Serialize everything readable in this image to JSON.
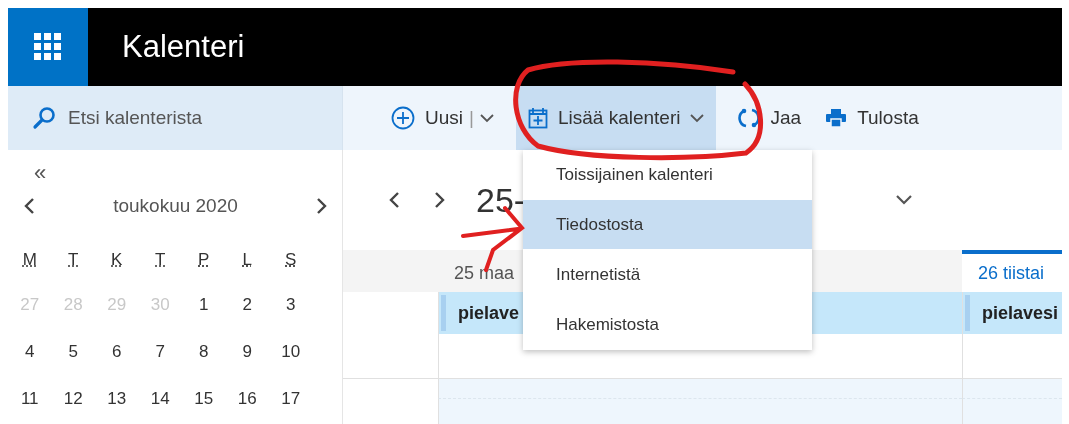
{
  "app": {
    "title": "Kalenteri"
  },
  "search": {
    "placeholder": "Etsi kalenterista"
  },
  "toolbar": [
    {
      "label": "Uusi",
      "kind": "new",
      "selected": false,
      "separator": "|"
    },
    {
      "label": "Lisää kalenteri",
      "kind": "add",
      "selected": true
    },
    {
      "label": "Jaa",
      "kind": "share",
      "selected": false
    },
    {
      "label": "Tulosta",
      "kind": "print",
      "selected": false
    }
  ],
  "mini_calendar": {
    "collapse": "«",
    "month": "toukokuu 2020",
    "weekdays": [
      "M",
      "T",
      "K",
      "T",
      "P",
      "L",
      "S"
    ],
    "weeks": [
      [
        {
          "label": "27",
          "muted": true
        },
        {
          "label": "28",
          "muted": true
        },
        {
          "label": "29",
          "muted": true
        },
        {
          "label": "30",
          "muted": true
        },
        {
          "label": "1",
          "muted": false
        },
        {
          "label": "2",
          "muted": false
        },
        {
          "label": "3",
          "muted": false
        }
      ],
      [
        {
          "label": "4",
          "muted": false
        },
        {
          "label": "5",
          "muted": false
        },
        {
          "label": "6",
          "muted": false
        },
        {
          "label": "7",
          "muted": false
        },
        {
          "label": "8",
          "muted": false
        },
        {
          "label": "9",
          "muted": false
        },
        {
          "label": "10",
          "muted": false
        }
      ],
      [
        {
          "label": "11",
          "muted": false
        },
        {
          "label": "12",
          "muted": false
        },
        {
          "label": "13",
          "muted": false
        },
        {
          "label": "14",
          "muted": false
        },
        {
          "label": "15",
          "muted": false
        },
        {
          "label": "16",
          "muted": false
        },
        {
          "label": "17",
          "muted": false
        }
      ]
    ]
  },
  "day_view": {
    "range": "25-",
    "days": [
      {
        "label": "25 maa",
        "today": false,
        "event": "pielave"
      },
      {
        "label": "26 tiistai",
        "today": true,
        "event": "pielavesi"
      }
    ]
  },
  "menu": {
    "items": [
      {
        "label": "Toissijainen kalenteri",
        "selected": false
      },
      {
        "label": "Tiedostosta",
        "selected": true
      },
      {
        "label": "Internetistä",
        "selected": false
      },
      {
        "label": "Hakemistosta",
        "selected": false
      }
    ]
  }
}
